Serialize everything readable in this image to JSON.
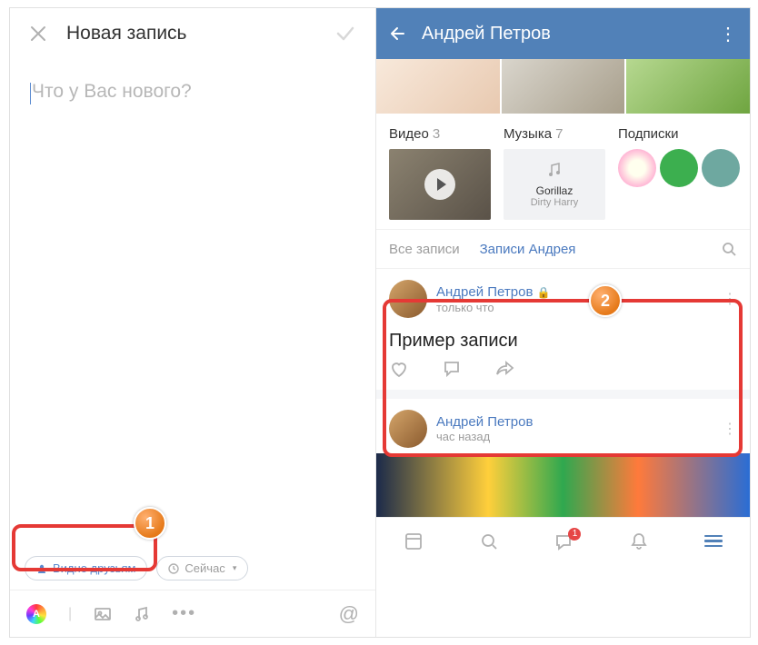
{
  "left": {
    "header_title": "Новая запись",
    "placeholder": "Что у Вас нового?",
    "visibility_chip": "Видно друзьям",
    "time_chip": "Сейчас"
  },
  "right": {
    "profile_name": "Андрей Петров",
    "sections": {
      "video": {
        "label": "Видео",
        "count": "3"
      },
      "music": {
        "label": "Музыка",
        "count": "7",
        "track_title": "Gorillaz",
        "track_sub": "Dirty Harry"
      },
      "subs": {
        "label": "Подписки"
      }
    },
    "tabs": {
      "all": "Все записи",
      "mine": "Записи Андрея"
    },
    "post1": {
      "author": "Андрей Петров",
      "time": "только что",
      "text": "Пример записи"
    },
    "post2": {
      "author": "Андрей Петров",
      "time": "час назад"
    },
    "badge_msg": "1"
  },
  "callouts": {
    "one": "1",
    "two": "2"
  }
}
